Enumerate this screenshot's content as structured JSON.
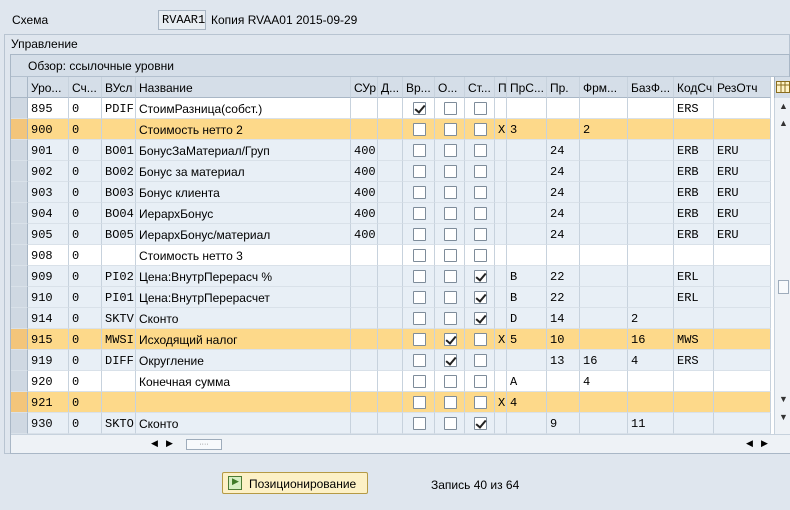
{
  "header": {
    "schema_label": "Схема",
    "schema_value": "RVAAR1",
    "schema_desc": "Копия RVAA01 2015-09-29"
  },
  "panel": {
    "title": "Управление"
  },
  "table": {
    "title": "Обзор: ссылочные уровни",
    "columns": [
      "Уро...",
      "Сч...",
      "ВУсл",
      "Название",
      "СУр",
      "Д...",
      "Вр...",
      "О...",
      "Ст...",
      "П",
      "ПрС...",
      "Пр.",
      "Фрм...",
      "БазФ...",
      "КодСч",
      "РезОтч"
    ],
    "rows": [
      {
        "lvl": "895",
        "cnt": "0",
        "cond": "PDIF",
        "name": "СтоимРазница(собст.)",
        "from": "",
        "to": "",
        "manual": true,
        "oblig": false,
        "stat": false,
        "p": "",
        "subtotal": "",
        "req": "",
        "calc": "",
        "base": "",
        "acct": "ERS",
        "accr": "",
        "style": "even"
      },
      {
        "lvl": "900",
        "cnt": "0",
        "cond": "",
        "name": "Стоимость нетто 2",
        "from": "",
        "to": "",
        "manual": false,
        "oblig": false,
        "stat": false,
        "p": "X",
        "subtotal": "3",
        "req": "",
        "calc": "2",
        "base": "",
        "acct": "",
        "accr": "",
        "style": "hl"
      },
      {
        "lvl": "901",
        "cnt": "0",
        "cond": "BO01",
        "name": "БонусЗаМатериал/Груп",
        "from": "400",
        "to": "",
        "manual": false,
        "oblig": false,
        "stat": false,
        "p": "",
        "subtotal": "",
        "req": "24",
        "calc": "",
        "base": "",
        "acct": "ERB",
        "accr": "ERU",
        "style": "odd"
      },
      {
        "lvl": "902",
        "cnt": "0",
        "cond": "BO02",
        "name": "Бонус за материал",
        "from": "400",
        "to": "",
        "manual": false,
        "oblig": false,
        "stat": false,
        "p": "",
        "subtotal": "",
        "req": "24",
        "calc": "",
        "base": "",
        "acct": "ERB",
        "accr": "ERU",
        "style": "odd"
      },
      {
        "lvl": "903",
        "cnt": "0",
        "cond": "BO03",
        "name": "Бонус клиента",
        "from": "400",
        "to": "",
        "manual": false,
        "oblig": false,
        "stat": false,
        "p": "",
        "subtotal": "",
        "req": "24",
        "calc": "",
        "base": "",
        "acct": "ERB",
        "accr": "ERU",
        "style": "odd"
      },
      {
        "lvl": "904",
        "cnt": "0",
        "cond": "BO04",
        "name": "ИерархБонус",
        "from": "400",
        "to": "",
        "manual": false,
        "oblig": false,
        "stat": false,
        "p": "",
        "subtotal": "",
        "req": "24",
        "calc": "",
        "base": "",
        "acct": "ERB",
        "accr": "ERU",
        "style": "odd"
      },
      {
        "lvl": "905",
        "cnt": "0",
        "cond": "BO05",
        "name": "ИерархБонус/материал",
        "from": "400",
        "to": "",
        "manual": false,
        "oblig": false,
        "stat": false,
        "p": "",
        "subtotal": "",
        "req": "24",
        "calc": "",
        "base": "",
        "acct": "ERB",
        "accr": "ERU",
        "style": "odd"
      },
      {
        "lvl": "908",
        "cnt": "0",
        "cond": "",
        "name": "Стоимость нетто 3",
        "from": "",
        "to": "",
        "manual": false,
        "oblig": false,
        "stat": false,
        "p": "",
        "subtotal": "",
        "req": "",
        "calc": "",
        "base": "",
        "acct": "",
        "accr": "",
        "style": "even"
      },
      {
        "lvl": "909",
        "cnt": "0",
        "cond": "PI02",
        "name": "Цена:ВнутрПерерасч %",
        "from": "",
        "to": "",
        "manual": false,
        "oblig": false,
        "stat": true,
        "p": "",
        "subtotal": "B",
        "req": "22",
        "calc": "",
        "base": "",
        "acct": "ERL",
        "accr": "",
        "style": "odd"
      },
      {
        "lvl": "910",
        "cnt": "0",
        "cond": "PI01",
        "name": "Цена:ВнутрПерерасчет",
        "from": "",
        "to": "",
        "manual": false,
        "oblig": false,
        "stat": true,
        "p": "",
        "subtotal": "B",
        "req": "22",
        "calc": "",
        "base": "",
        "acct": "ERL",
        "accr": "",
        "style": "odd"
      },
      {
        "lvl": "914",
        "cnt": "0",
        "cond": "SKTV",
        "name": "Сконто",
        "from": "",
        "to": "",
        "manual": false,
        "oblig": false,
        "stat": true,
        "p": "",
        "subtotal": "D",
        "req": "14",
        "calc": "",
        "base": "2",
        "acct": "",
        "accr": "",
        "style": "odd"
      },
      {
        "lvl": "915",
        "cnt": "0",
        "cond": "MWSI",
        "name": "Исходящий налог",
        "from": "",
        "to": "",
        "manual": false,
        "oblig": true,
        "stat": false,
        "p": "X",
        "subtotal": "5",
        "req": "10",
        "calc": "",
        "base": "16",
        "acct": "MWS",
        "accr": "",
        "style": "hl"
      },
      {
        "lvl": "919",
        "cnt": "0",
        "cond": "DIFF",
        "name": "Округление",
        "from": "",
        "to": "",
        "manual": false,
        "oblig": true,
        "stat": false,
        "p": "",
        "subtotal": "",
        "req": "13",
        "calc": "16",
        "base": "4",
        "acct": "ERS",
        "accr": "",
        "style": "odd"
      },
      {
        "lvl": "920",
        "cnt": "0",
        "cond": "",
        "name": "Конечная сумма",
        "from": "",
        "to": "",
        "manual": false,
        "oblig": false,
        "stat": false,
        "p": "",
        "subtotal": "A",
        "req": "",
        "calc": "4",
        "base": "",
        "acct": "",
        "accr": "",
        "style": "even"
      },
      {
        "lvl": "921",
        "cnt": "0",
        "cond": "",
        "name": "",
        "from": "",
        "to": "",
        "manual": false,
        "oblig": false,
        "stat": false,
        "p": "X",
        "subtotal": "4",
        "req": "",
        "calc": "",
        "base": "",
        "acct": "",
        "accr": "",
        "style": "hl"
      },
      {
        "lvl": "930",
        "cnt": "0",
        "cond": "SKTO",
        "name": "Сконто",
        "from": "",
        "to": "",
        "manual": false,
        "oblig": false,
        "stat": true,
        "p": "",
        "subtotal": "",
        "req": "9",
        "calc": "",
        "base": "11",
        "acct": "",
        "accr": "",
        "style": "odd"
      }
    ]
  },
  "footer": {
    "position_button": "Позиционирование",
    "record_info": "Запись 40 из 64"
  },
  "colors": {
    "highlight": "#fdd98a",
    "row_alt": "#e8eff6",
    "header": "#d5dee8"
  }
}
